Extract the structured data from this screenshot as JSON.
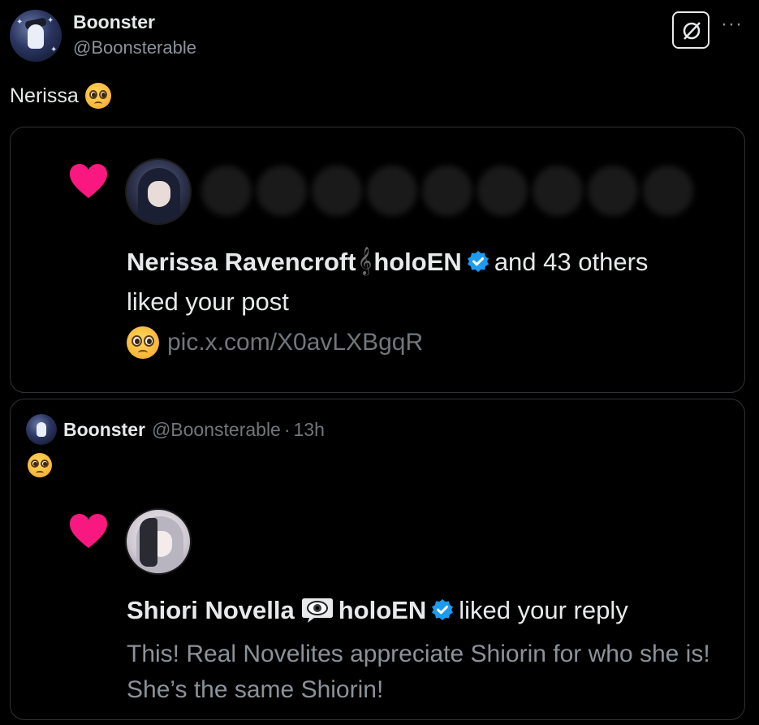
{
  "post": {
    "author_name": "Boonster",
    "author_handle": "@Boonsterable",
    "text": "Nerissa",
    "text_emoji": "pleading-face"
  },
  "card1": {
    "liker_name": "Nerissa Ravencroft",
    "liker_org": "holoEN",
    "others_text": "and 43 others",
    "action_text": "liked your post",
    "link": "pic.x.com/X0avLXBgqR"
  },
  "card2": {
    "author_name": "Boonster",
    "author_handle": "@Boonsterable",
    "time": "13h",
    "separator": "·",
    "liker_name": "Shiori Novella",
    "liker_org": "holoEN",
    "action_text": "liked your reply",
    "reply_text": "This! Real Novelites appreciate Shiorin for who she is! She’s the same Shiorin!"
  },
  "colors": {
    "background": "#000000",
    "text_primary": "#e7e9ea",
    "text_secondary": "#71767b",
    "heart": "#f91880",
    "verified": "#1d9bf0",
    "border": "#2f3336"
  },
  "icons": [
    "grok-icon",
    "more-icon",
    "heart-icon",
    "verified-badge-icon",
    "music-note-icon",
    "eye-speech-icon",
    "pleading-face-emoji"
  ]
}
